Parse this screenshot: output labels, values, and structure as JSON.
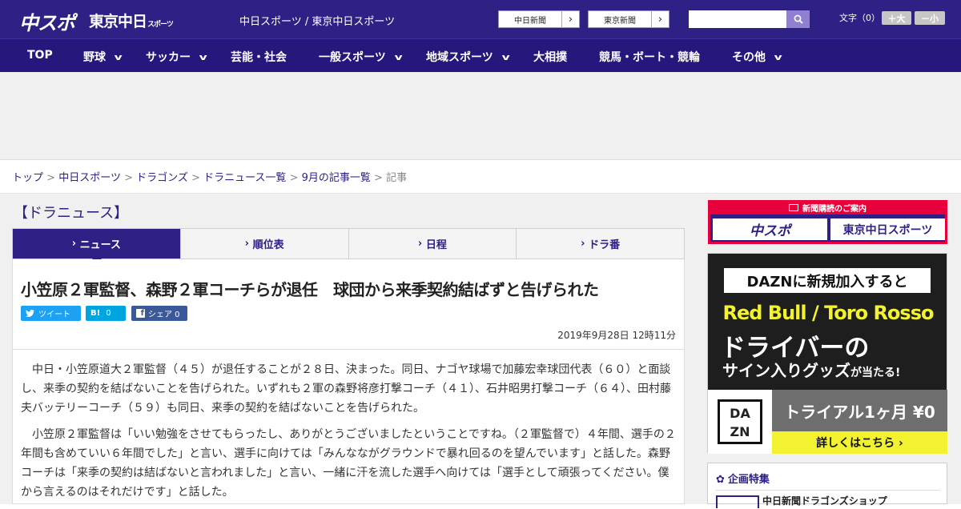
{
  "header": {
    "logo_chuspo": "中スポ",
    "logo_tokyo": "東京中日",
    "logo_tokyo_sub": "スポーツ",
    "site_name": "中日スポーツ / 東京中日スポーツ",
    "paper_links": [
      {
        "label": "中日新聞"
      },
      {
        "label": "東京新聞"
      }
    ],
    "search": {
      "placeholder": "",
      "value": ""
    },
    "font_size_label": "文字（0）",
    "font_bigger": "＋大",
    "font_smaller": "－小"
  },
  "nav": {
    "items": [
      {
        "label": "TOP",
        "dropdown": false
      },
      {
        "label": "野球",
        "dropdown": true
      },
      {
        "label": "サッカー",
        "dropdown": true
      },
      {
        "label": "芸能・社会",
        "dropdown": false
      },
      {
        "label": "一般スポーツ",
        "dropdown": true
      },
      {
        "label": "地域スポーツ",
        "dropdown": true
      },
      {
        "label": "大相撲",
        "dropdown": false
      },
      {
        "label": "競馬・ボート・競輪",
        "dropdown": false
      },
      {
        "label": "その他",
        "dropdown": true
      }
    ]
  },
  "breadcrumb": [
    {
      "label": "トップ",
      "link": true
    },
    {
      "label": "中日スポーツ",
      "link": true
    },
    {
      "label": "ドラゴンズ",
      "link": true
    },
    {
      "label": "ドラニュース一覧",
      "link": true
    },
    {
      "label": "9月の記事一覧",
      "link": true
    },
    {
      "label": "記事",
      "link": false
    }
  ],
  "breadcrumb_sep": ">",
  "section_title": "【ドラニュース】",
  "tabs": [
    {
      "label": "ニュース",
      "active": true
    },
    {
      "label": "順位表",
      "active": false
    },
    {
      "label": "日程",
      "active": false
    },
    {
      "label": "ドラ番",
      "active": false
    }
  ],
  "tab_chevron": "›",
  "article": {
    "title": "小笠原２軍監督、森野２軍コーチらが退任　球団から来季契約結ばずと告げられた",
    "share": {
      "tweet": "ツイート",
      "hatena": "B!",
      "hatena_count": "0",
      "facebook": "シェア 0"
    },
    "date": "2019年9月28日 12時11分",
    "paragraphs": [
      "中日・小笠原道大２軍監督（４５）が退任することが２８日、決まった。同日、ナゴヤ球場で加藤宏幸球団代表（６０）と面談し、来季の契約を結ばないことを告げられた。いずれも２軍の森野将彦打撃コーチ（４１）、石井昭男打撃コーチ（６４）、田村藤夫バッテリーコーチ（５９）も同日、来季の契約を結ばないことを告げられた。",
      "小笠原２軍監督は「いい勉強をさせてもらったし、ありがとうございましたということですね。（２軍監督で）４年間、選手の２年間も含めていい６年間でした」と言い、選手に向けては「みんなながグラウンドで暴れ回るのを望んでいます」と話した。森野コーチは「来季の契約は結ばないと言われました」と言い、一緒に汗を流した選手へ向けては「選手として頑張ってください。僕から言えるのはそれだけです」と話した。"
    ]
  },
  "sidebar": {
    "subscribe_title": "新聞購読のご案内",
    "subscribe_links": [
      {
        "label": "中スポ"
      },
      {
        "label": "東京中日スポーツ"
      }
    ],
    "dazn_ad": {
      "headline": "DAZNに新規加入すると",
      "teams": "Red Bull / Toro Rosso",
      "driver": "ドライバーの",
      "goods": "サイン入りグッズ",
      "goods_suffix": "が当たる!",
      "logo": "DA ZN",
      "trial": "トライアル1ヶ月 ¥0",
      "cta": "詳しくはこちら ›"
    },
    "feature": {
      "title": "企画特集",
      "first_item": "中日新聞ドラゴンズショップ"
    }
  },
  "colors": {
    "brand": "#2d2185",
    "nav": "#25177c",
    "subscribe_red": "#e8003d",
    "twitter": "#1da1f2",
    "hatena": "#00a4de",
    "facebook": "#3b5998",
    "dazn_yellow": "#f2f230"
  }
}
